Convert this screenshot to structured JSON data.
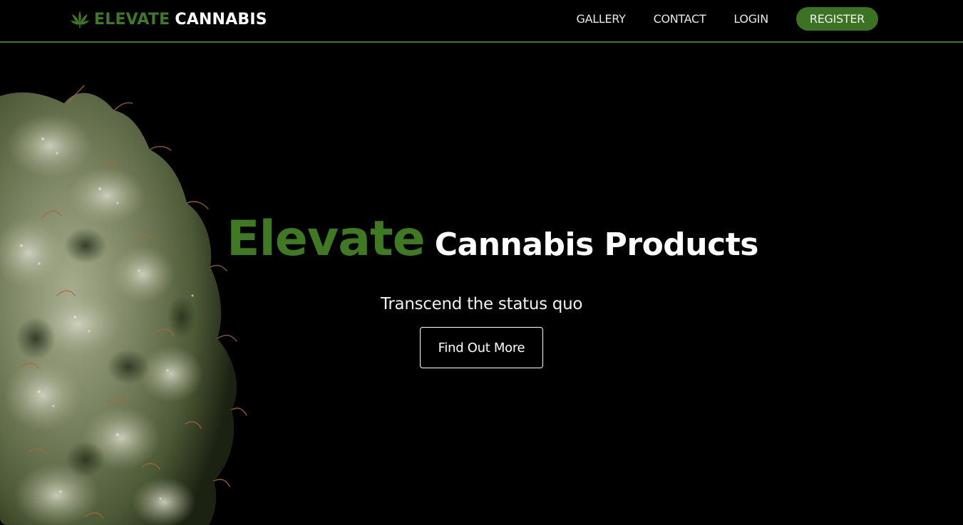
{
  "colors": {
    "accent_green": "#3f7a22",
    "register_green": "#3b7322",
    "background": "#000000",
    "text_light": "#ffffff"
  },
  "navbar": {
    "brand": {
      "icon": "cannabis-leaf-icon",
      "word1": "ELEVATE",
      "word2": "CANNABIS"
    },
    "links": {
      "gallery": "GALLERY",
      "contact": "CONTACT",
      "login": "LOGIN",
      "register": "REGISTER"
    }
  },
  "hero": {
    "image": "cannabis-bud-photo",
    "title_accent": "Elevate",
    "title_rest": "Cannabis Products",
    "subtitle": "Transcend the status quo",
    "cta_label": "Find Out More"
  }
}
